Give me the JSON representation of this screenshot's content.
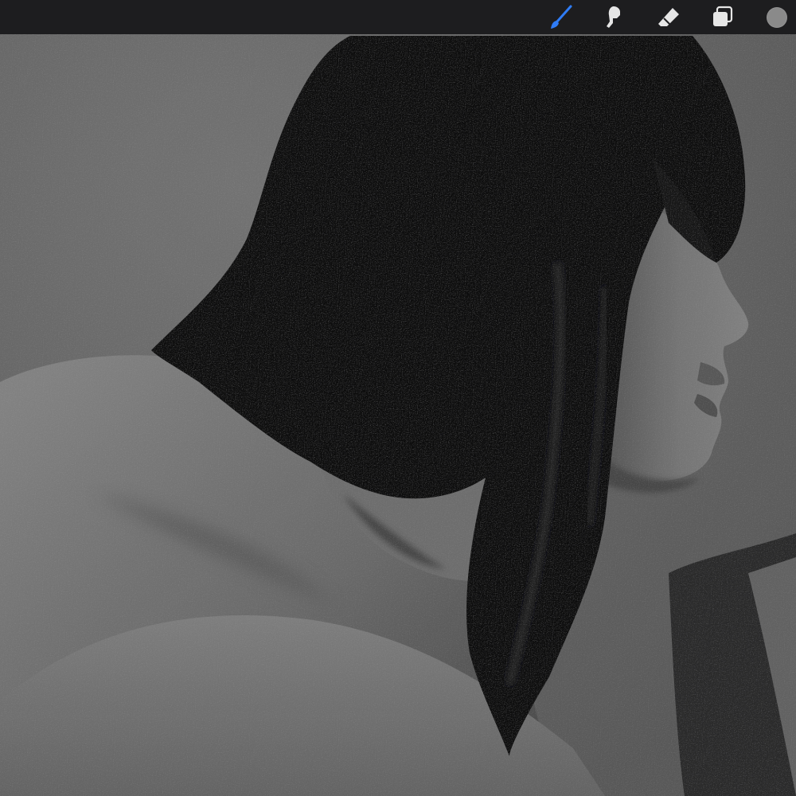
{
  "toolbar": {
    "tools": [
      {
        "id": "brush",
        "icon": "brush-icon",
        "active": true,
        "color": "#2f7cf6"
      },
      {
        "id": "smudge",
        "icon": "smudge-icon",
        "active": false,
        "color": "#e6e6e6"
      },
      {
        "id": "eraser",
        "icon": "eraser-icon",
        "active": false,
        "color": "#e6e6e6"
      },
      {
        "id": "layers",
        "icon": "layers-icon",
        "active": false,
        "color": "#e6e6e6"
      }
    ],
    "current_color": "#8a8a8a"
  },
  "canvas": {
    "artwork": "grayscale-portrait-painting",
    "palette": {
      "background": "#707070",
      "hair": "#0c0c0d",
      "skin_light": "#8e8e8e",
      "skin_mid": "#6a6a6a",
      "skin_shadow": "#3d3d3d",
      "garment": "#2c2c2c"
    }
  }
}
